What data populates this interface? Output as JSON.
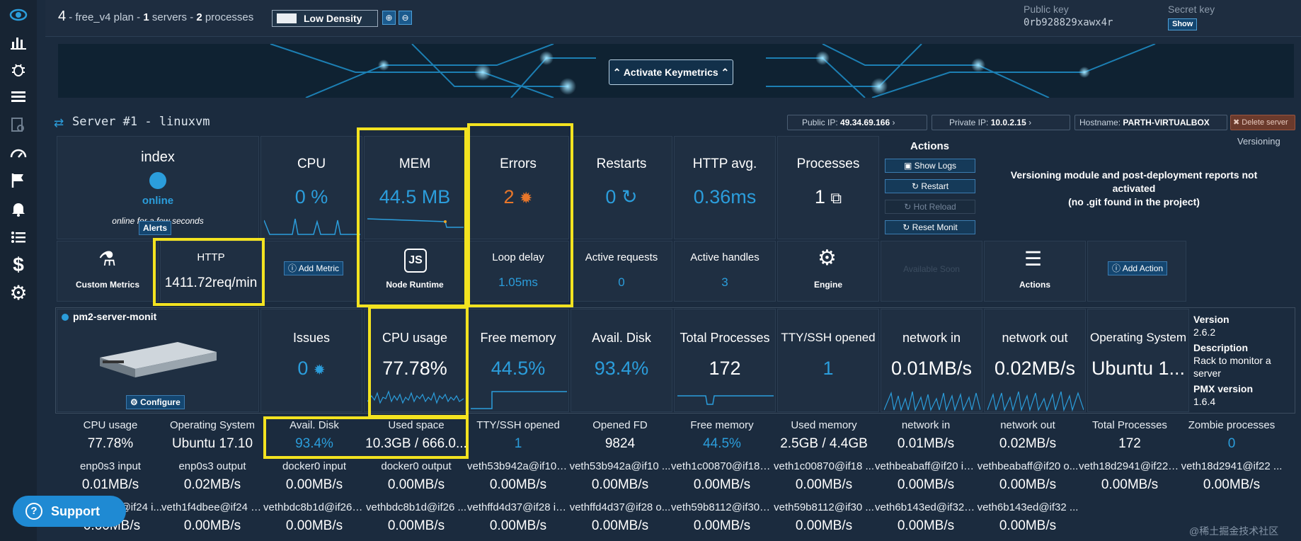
{
  "topbar": {
    "server_count": "4",
    "plan_desc_prefix": " - free_v4 plan - ",
    "servers_num": "1",
    "servers_word": " servers - ",
    "processes_num": "2",
    "processes_word": " processes",
    "density_label": "Low Density",
    "public_key_label": "Public key",
    "public_key_value": "0rb928829xawx4r",
    "secret_key_label": "Secret key",
    "secret_key_show": "Show"
  },
  "banner": {
    "activate_label": "Activate Keymetrics"
  },
  "server": {
    "title": "Server #1 - linuxvm",
    "public_ip_label": "Public IP:",
    "public_ip": "49.34.69.166",
    "private_ip_label": "Private IP:",
    "private_ip": "10.0.2.15",
    "hostname_label": "Hostname:",
    "hostname": "PARTH-VIRTUALBOX",
    "delete_label": "Delete server",
    "versioning_label": "Versioning",
    "versioning_msg_1": "Versioning module and post-deployment reports not",
    "versioning_msg_2": "activated",
    "versioning_msg_3": "(no .git found in the project)"
  },
  "process": {
    "name": "index",
    "status": "online",
    "status_detail": "online for a few seconds",
    "alerts_label": "Alerts"
  },
  "metrics_row1": {
    "cpu_label": "CPU",
    "cpu_value": "0 %",
    "mem_label": "MEM",
    "mem_value": "44.5 MB",
    "errors_label": "Errors",
    "errors_value": "2",
    "restarts_label": "Restarts",
    "restarts_value": "0",
    "http_avg_label": "HTTP avg.",
    "http_avg_value": "0.36ms",
    "processes_label": "Processes",
    "processes_value": "1"
  },
  "actions": {
    "title": "Actions",
    "show_logs": "Show Logs",
    "restart": "Restart",
    "hot_reload": "Hot Reload",
    "reset_monit": "Reset Monit"
  },
  "metrics_row2": {
    "custom_metrics_label": "Custom Metrics",
    "http_label": "HTTP",
    "http_value": "1411.72req/min",
    "add_metric_label": "Add Metric",
    "node_runtime_label": "Node Runtime",
    "loop_delay_label": "Loop delay",
    "loop_delay_value": "1.05ms",
    "active_requests_label": "Active requests",
    "active_requests_value": "0",
    "active_handles_label": "Active handles",
    "active_handles_value": "3",
    "engine_label": "Engine",
    "available_soon_label": "Available Soon",
    "actions_label": "Actions",
    "add_action_label": "Add Action"
  },
  "monit": {
    "name": "pm2-server-monit",
    "configure_label": "Configure",
    "issues_label": "Issues",
    "issues_value": "0",
    "cpu_usage_label": "CPU usage",
    "cpu_usage_value": "77.78%",
    "free_memory_label": "Free memory",
    "free_memory_value": "44.5%",
    "avail_disk_label": "Avail. Disk",
    "avail_disk_value": "93.4%",
    "total_processes_label": "Total Processes",
    "total_processes_value": "172",
    "tty_label": "TTY/SSH opened",
    "tty_value": "1",
    "net_in_label": "network in",
    "net_in_value": "0.01MB/s",
    "net_out_label": "network out",
    "net_out_value": "0.02MB/s",
    "os_label": "Operating System",
    "os_value": "Ubuntu 1...",
    "version_label": "Version",
    "version_value": "2.6.2",
    "description_label": "Description",
    "description_value": "Rack to monitor a server",
    "pmx_label": "PMX version",
    "pmx_value": "1.6.4"
  },
  "table_rows": [
    [
      {
        "k": "CPU usage",
        "v": "77.78%",
        "c": "white"
      },
      {
        "k": "Operating System",
        "v": "Ubuntu 17.10",
        "c": "white"
      },
      {
        "k": "Avail. Disk",
        "v": "93.4%",
        "c": "blue"
      },
      {
        "k": "Used space",
        "v": "10.3GB / 666.0...",
        "c": "white"
      },
      {
        "k": "TTY/SSH opened",
        "v": "1",
        "c": "blue"
      },
      {
        "k": "Opened FD",
        "v": "9824",
        "c": "white"
      },
      {
        "k": "Free memory",
        "v": "44.5%",
        "c": "blue"
      },
      {
        "k": "Used memory",
        "v": "2.5GB / 4.4GB",
        "c": "white"
      },
      {
        "k": "network in",
        "v": "0.01MB/s",
        "c": "white"
      },
      {
        "k": "network out",
        "v": "0.02MB/s",
        "c": "white"
      },
      {
        "k": "Total Processes",
        "v": "172",
        "c": "white"
      },
      {
        "k": "Zombie processes",
        "v": "0",
        "c": "blue"
      }
    ],
    [
      {
        "k": "enp0s3 input",
        "v": "0.01MB/s",
        "c": "white"
      },
      {
        "k": "enp0s3 output",
        "v": "0.02MB/s",
        "c": "white"
      },
      {
        "k": "docker0 input",
        "v": "0.00MB/s",
        "c": "white"
      },
      {
        "k": "docker0 output",
        "v": "0.00MB/s",
        "c": "white"
      },
      {
        "k": "veth53b942a@if10 i...",
        "v": "0.00MB/s",
        "c": "white"
      },
      {
        "k": "veth53b942a@if10 ...",
        "v": "0.00MB/s",
        "c": "white"
      },
      {
        "k": "veth1c00870@if18 i...",
        "v": "0.00MB/s",
        "c": "white"
      },
      {
        "k": "veth1c00870@if18 ...",
        "v": "0.00MB/s",
        "c": "white"
      },
      {
        "k": "vethbeabaff@if20 in...",
        "v": "0.00MB/s",
        "c": "white"
      },
      {
        "k": "vethbeabaff@if20 o...",
        "v": "0.00MB/s",
        "c": "white"
      },
      {
        "k": "veth18d2941@if22 i...",
        "v": "0.00MB/s",
        "c": "white"
      },
      {
        "k": "veth18d2941@if22 ...",
        "v": "0.00MB/s",
        "c": "white"
      }
    ],
    [
      {
        "k": "veth1f4dbee@if24 i...",
        "v": "0.00MB/s",
        "c": "white"
      },
      {
        "k": "veth1f4dbee@if24 o...",
        "v": "0.00MB/s",
        "c": "white"
      },
      {
        "k": "vethbdc8b1d@if26 i...",
        "v": "0.00MB/s",
        "c": "white"
      },
      {
        "k": "vethbdc8b1d@if26 ...",
        "v": "0.00MB/s",
        "c": "white"
      },
      {
        "k": "vethffd4d37@if28 in...",
        "v": "0.00MB/s",
        "c": "white"
      },
      {
        "k": "vethffd4d37@if28 o...",
        "v": "0.00MB/s",
        "c": "white"
      },
      {
        "k": "veth59b8112@if30 i...",
        "v": "0.00MB/s",
        "c": "white"
      },
      {
        "k": "veth59b8112@if30 ...",
        "v": "0.00MB/s",
        "c": "white"
      },
      {
        "k": "veth6b143ed@if32 i...",
        "v": "0.00MB/s",
        "c": "white"
      },
      {
        "k": "veth6b143ed@if32 ...",
        "v": "0.00MB/s",
        "c": "white"
      }
    ]
  ],
  "support_label": "Support",
  "watermark": "@稀土掘金技术社区",
  "colors": {
    "accent": "#2b9ddb",
    "highlight": "#f3e320",
    "error": "#e8762a",
    "background": "#1b2b3e"
  }
}
